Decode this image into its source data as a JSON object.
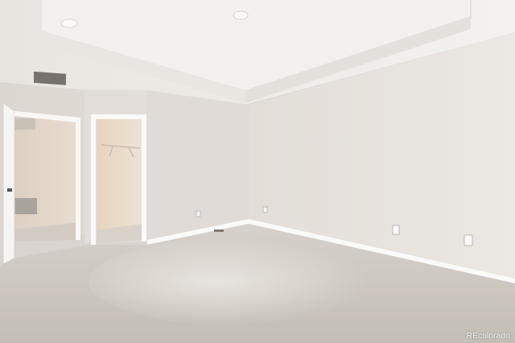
{
  "photo": {
    "subject": "empty-bedroom-interior",
    "watermark": "REcolorado"
  },
  "colors": {
    "ceiling": "#efece8",
    "wall_right": "#e6e1dc",
    "wall_back": "#e2ddd8",
    "carpet": "#cfc9c2",
    "trim": "#fafafa",
    "closet_interior": "#e9d9c6",
    "hallway_wall": "#e4d6c8"
  }
}
